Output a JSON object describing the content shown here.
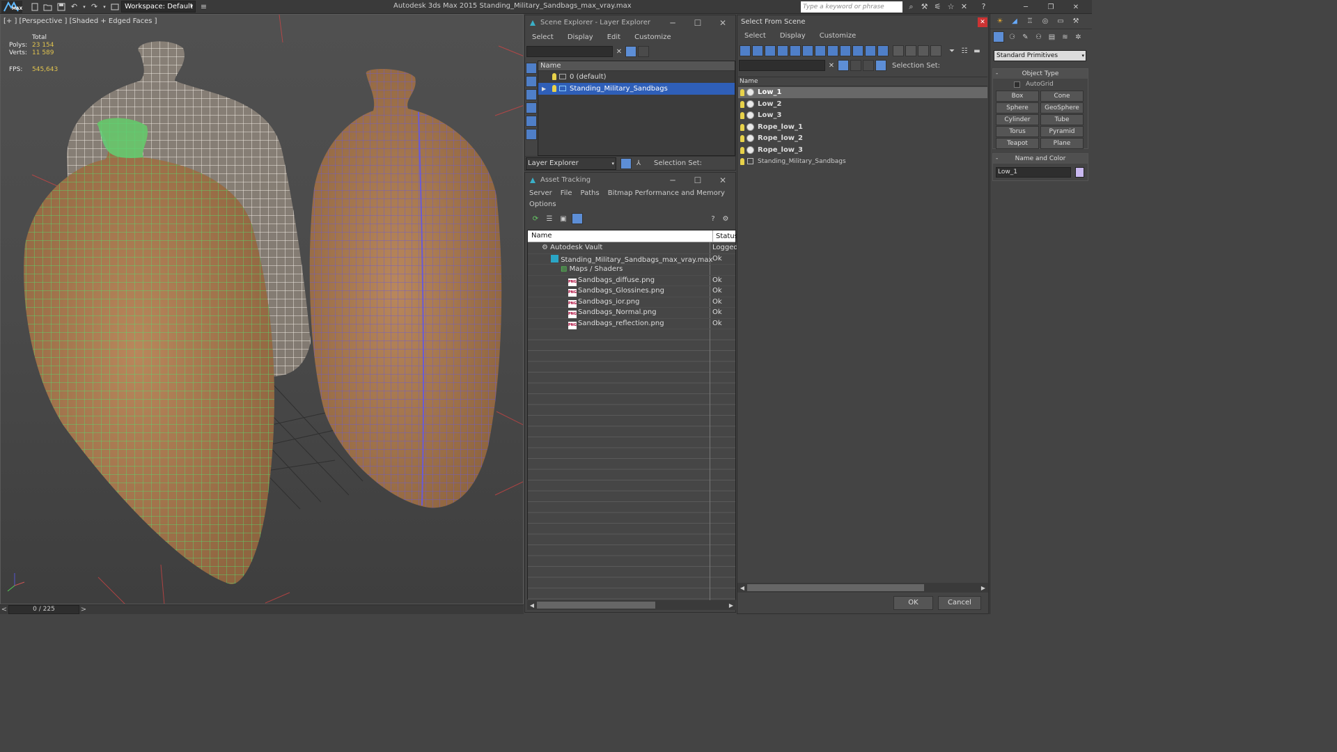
{
  "titlebar": {
    "logo": "MAX",
    "workspace": "Workspace: Default",
    "app_title": "Autodesk 3ds Max  2015     Standing_Military_Sandbags_max_vray.max",
    "search_placeholder": "Type a keyword or phrase"
  },
  "viewport": {
    "label": "[+ ] [Perspective ] [Shaded + Edged Faces ]",
    "stats": {
      "total_label": "Total",
      "polys_label": "Polys:",
      "polys_value": "23 154",
      "verts_label": "Verts:",
      "verts_value": "11 589",
      "fps_label": "FPS:",
      "fps_value": "545,643"
    },
    "timeline": "0 / 225",
    "nav_left": "<",
    "nav_right": ">"
  },
  "scene_explorer": {
    "title": "Scene Explorer - Layer Explorer",
    "menu": [
      "Select",
      "Display",
      "Edit",
      "Customize"
    ],
    "column_name": "Name",
    "layers": [
      "0 (default)",
      "Standing_Military_Sandbags"
    ],
    "footer_dropdown": "Layer Explorer",
    "selection_set_label": "Selection Set:"
  },
  "asset_tracking": {
    "title": "Asset Tracking",
    "menu": [
      "Server",
      "File",
      "Paths",
      "Bitmap Performance and Memory"
    ],
    "menu2": "Options",
    "col_name": "Name",
    "col_status": "Status",
    "rows": [
      {
        "name": "Autodesk Vault",
        "status": "Logged",
        "icon": "vault-icon"
      },
      {
        "name": "Standing_Military_Sandbags_max_vray.max",
        "status": "Ok",
        "icon": "max-file-icon"
      },
      {
        "name": "Maps / Shaders",
        "status": "",
        "icon": "maps-icon"
      },
      {
        "name": "Sandbags_diffuse.png",
        "status": "Ok",
        "icon": "png-icon"
      },
      {
        "name": "Sandbags_Glossines.png",
        "status": "Ok",
        "icon": "png-icon"
      },
      {
        "name": "Sandbags_ior.png",
        "status": "Ok",
        "icon": "png-icon"
      },
      {
        "name": "Sandbags_Normal.png",
        "status": "Ok",
        "icon": "png-icon"
      },
      {
        "name": "Sandbags_reflection.png",
        "status": "Ok",
        "icon": "png-icon"
      }
    ],
    "png_badge": "PNG"
  },
  "select_from_scene": {
    "title": "Select From Scene",
    "menu": [
      "Select",
      "Display",
      "Customize"
    ],
    "selection_set_label": "Selection Set:",
    "column_name": "Name",
    "objects": [
      "Low_1",
      "Low_2",
      "Low_3",
      "Rope_low_1",
      "Rope_low_2",
      "Rope_low_3",
      "Standing_Military_Sandbags"
    ],
    "ok": "OK",
    "cancel": "Cancel"
  },
  "command_panel": {
    "dropdown": "Standard Primitives",
    "object_type_title": "Object Type",
    "autogrid": "AutoGrid",
    "buttons": [
      "Box",
      "Cone",
      "Sphere",
      "GeoSphere",
      "Cylinder",
      "Tube",
      "Torus",
      "Pyramid",
      "Teapot",
      "Plane"
    ],
    "name_color_title": "Name and Color",
    "name_value": "Low_1",
    "swatch_color": "#c9b8f0"
  }
}
